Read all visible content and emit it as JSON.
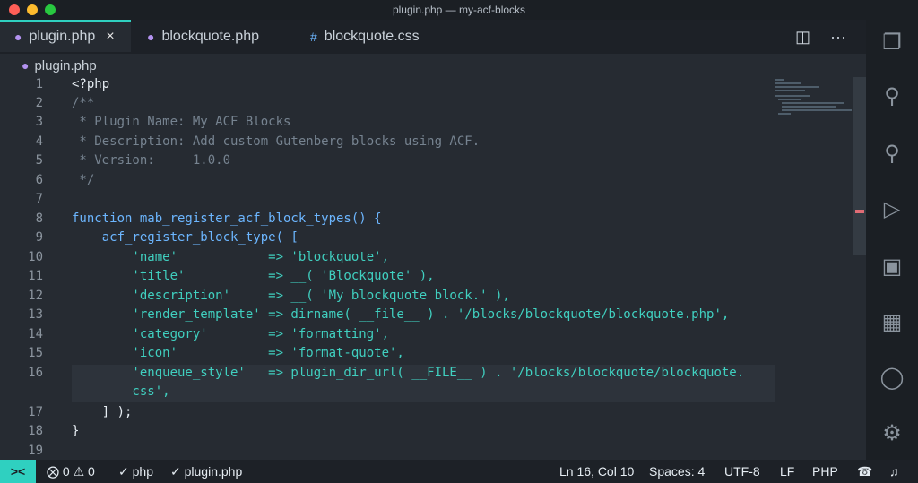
{
  "window": {
    "title": "plugin.php — my-acf-blocks"
  },
  "tabs": [
    {
      "label": "plugin.php",
      "icon": "php-elephant-icon",
      "active": true
    },
    {
      "label": "blockquote.php",
      "icon": "php-elephant-icon",
      "active": false
    },
    {
      "label": "blockquote.css",
      "icon": "hash-icon",
      "active": false
    }
  ],
  "breadcrumb": {
    "label": "plugin.php",
    "icon": "php-elephant-icon"
  },
  "editor": {
    "line_numbers": [
      "1",
      "2",
      "3",
      "4",
      "5",
      "6",
      "7",
      "8",
      "9",
      "10",
      "11",
      "12",
      "13",
      "14",
      "15",
      "16",
      "17",
      "18",
      "19"
    ],
    "lines": [
      "<?php",
      "/**",
      " * Plugin Name: My ACF Blocks",
      " * Description: Add custom Gutenberg blocks using ACF.",
      " * Version:     1.0.0",
      " */",
      "",
      "function mab_register_acf_block_types() {",
      "    acf_register_block_type( [",
      "        'name'            => 'blockquote',",
      "        'title'           => __( 'Blockquote' ),",
      "        'description'     => __( 'My blockquote block.' ),",
      "        'render_template' => dirname( __file__ ) . '/blocks/blockquote/blockquote.php',",
      "        'category'        => 'formatting',",
      "        'icon'            => 'format-quote',",
      "        'enqueue_style'   => plugin_dir_url( __FILE__ ) . '/blocks/blockquote/blockquote.",
      "        css',",
      "    ] );",
      "}",
      ""
    ]
  },
  "status": {
    "errors": "0",
    "warnings": "0",
    "php_check": "php",
    "file_check": "plugin.php",
    "position": "Ln 16, Col 10",
    "spaces": "Spaces: 4",
    "encoding": "UTF-8",
    "eol": "LF",
    "language": "PHP"
  },
  "colors": {
    "accent": "#2fd0c0",
    "background": "#262b32"
  }
}
